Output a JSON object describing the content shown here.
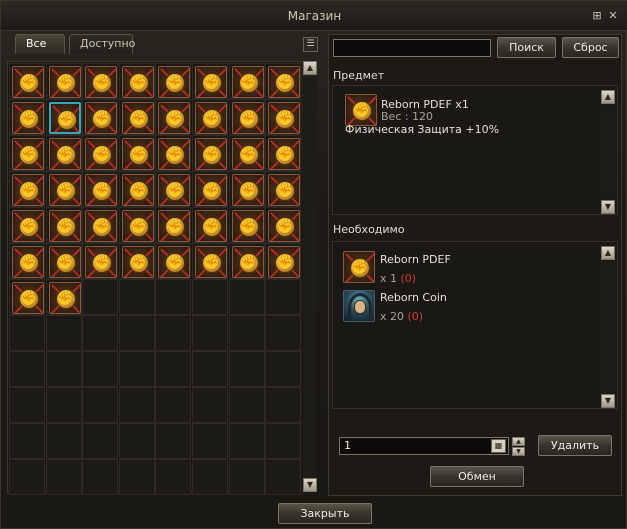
{
  "window": {
    "title": "Магазин"
  },
  "titlebar_icons": [
    "resize-icon",
    "close-icon"
  ],
  "tabs": [
    {
      "label": "Все",
      "active": true
    },
    {
      "label": "Доступно",
      "active": false
    }
  ],
  "inventory": {
    "columns": 8,
    "total_slots": 96,
    "item_icon": "fist-emblem-icon",
    "item_count": 50,
    "selected_index": 9
  },
  "search": {
    "value": "",
    "search_label": "Поиск",
    "reset_label": "Сброс"
  },
  "item_section": {
    "label": "Предмет",
    "name": "Reborn PDEF x1",
    "weight": "Вес : 120",
    "description": "Физическая Защита +10%"
  },
  "required_section": {
    "label": "Необходимо",
    "items": [
      {
        "name": "Reborn PDEF",
        "qty": "x 1",
        "owned": "(0)",
        "icon": "fist-emblem-icon"
      },
      {
        "name": "Reborn Coin",
        "qty": "x 20",
        "owned": "(0)",
        "icon": "hooded-figure-icon"
      }
    ]
  },
  "quantity": {
    "value": "1"
  },
  "buttons": {
    "delete": "Удалить",
    "exchange": "Обмен",
    "close": "Закрыть"
  },
  "colors": {
    "accent_red": "#d03a2a",
    "selection": "#3aa7b8",
    "background": "#1a1712"
  }
}
